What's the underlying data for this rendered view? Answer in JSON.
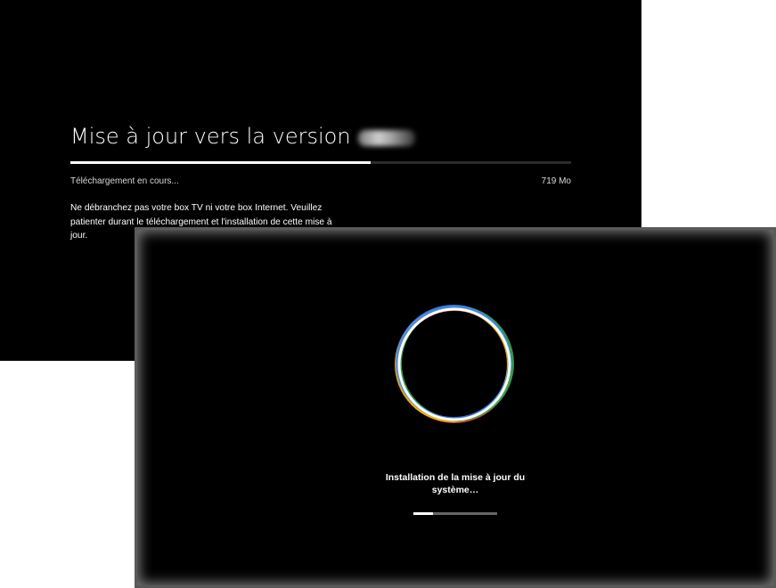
{
  "download_screen": {
    "title": "Mise à jour vers la version",
    "progress_percent": 60,
    "status": "Téléchargement en cours...",
    "size": "719 Mo",
    "warning": "Ne débranchez pas votre box TV ni votre box Internet. Veuillez patienter durant le téléchargement et l'installation de cette mise à jour."
  },
  "install_screen": {
    "status": "Installation de la mise à jour du système…",
    "progress_percent": 23,
    "ring_colors": [
      "#ea4335",
      "#fbbc05",
      "#34a853",
      "#4285f4",
      "#ffffff"
    ]
  }
}
